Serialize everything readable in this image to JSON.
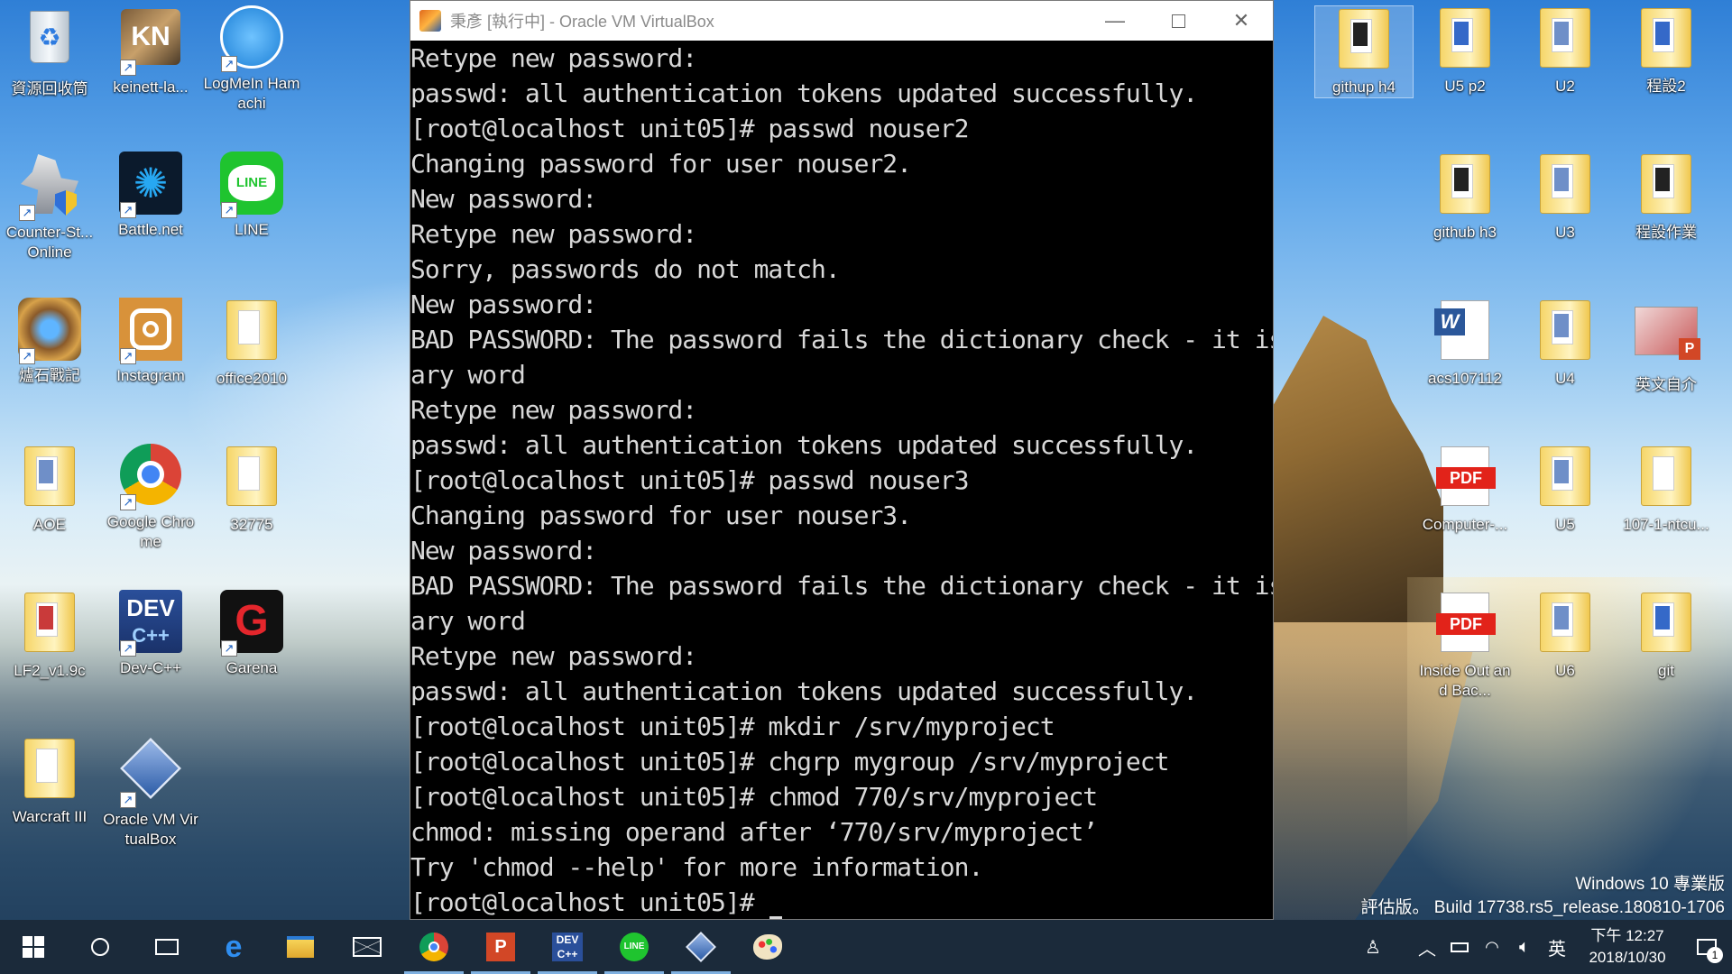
{
  "desktop": {
    "left_icons": [
      {
        "label": "資源回收筒",
        "icon": "recycle-bin-icon"
      },
      {
        "label": "keinett-la...",
        "icon": "keinett-icon"
      },
      {
        "label": "LogMeIn Hamachi",
        "icon": "hamachi-icon"
      },
      {
        "label": "Counter-St... Online",
        "icon": "counter-strike-icon"
      },
      {
        "label": "Battle.net",
        "icon": "battlenet-icon"
      },
      {
        "label": "LINE",
        "icon": "line-icon"
      },
      {
        "label": "爐石戰記",
        "icon": "hearthstone-icon"
      },
      {
        "label": "Instagram",
        "icon": "instagram-icon"
      },
      {
        "label": "office2010",
        "icon": "folder-icon"
      },
      {
        "label": "AOE",
        "icon": "folder-icon"
      },
      {
        "label": "Google Chrome",
        "icon": "chrome-icon"
      },
      {
        "label": "32775",
        "icon": "folder-icon"
      },
      {
        "label": "LF2_v1.9c",
        "icon": "folder-icon"
      },
      {
        "label": "Dev-C++",
        "icon": "devcpp-icon"
      },
      {
        "label": "Garena",
        "icon": "garena-icon"
      },
      {
        "label": "Warcraft III",
        "icon": "folder-icon"
      },
      {
        "label": "Oracle VM VirtualBox",
        "icon": "virtualbox-icon"
      }
    ],
    "right_icons": [
      {
        "label": "githup h4",
        "icon": "folder-icon"
      },
      {
        "label": "U5 p2",
        "icon": "folder-icon"
      },
      {
        "label": "U2",
        "icon": "folder-icon"
      },
      {
        "label": "程設2",
        "icon": "folder-icon"
      },
      {
        "label": "github h3",
        "icon": "folder-icon"
      },
      {
        "label": "U3",
        "icon": "folder-icon"
      },
      {
        "label": "程設作業",
        "icon": "folder-icon"
      },
      {
        "label": "acs107112",
        "icon": "word-doc-icon"
      },
      {
        "label": "U4",
        "icon": "folder-icon"
      },
      {
        "label": "英文自介",
        "icon": "powerpoint-icon"
      },
      {
        "label": "Computer-...",
        "icon": "pdf-icon"
      },
      {
        "label": "U5",
        "icon": "folder-icon"
      },
      {
        "label": "107-1-ntcu...",
        "icon": "folder-icon"
      },
      {
        "label": "Inside Out and Bac...",
        "icon": "pdf-icon"
      },
      {
        "label": "U6",
        "icon": "folder-icon"
      },
      {
        "label": "git",
        "icon": "folder-icon"
      }
    ]
  },
  "vbox": {
    "title": "秉彥 [執行中] - Oracle VM VirtualBox",
    "terminal_lines": [
      "Retype new password:",
      "passwd: all authentication tokens updated successfully.",
      "[root@localhost unit05]# passwd nouser2",
      "Changing password for user nouser2.",
      "New password:",
      "Retype new password:",
      "Sorry, passwords do not match.",
      "New password:",
      "BAD PASSWORD: The password fails the dictionary check - it is based on a diction",
      "ary word",
      "Retype new password:",
      "passwd: all authentication tokens updated successfully.",
      "[root@localhost unit05]# passwd nouser3",
      "Changing password for user nouser3.",
      "New password:",
      "BAD PASSWORD: The password fails the dictionary check - it is based on a diction",
      "ary word",
      "Retype new password:",
      "passwd: all authentication tokens updated successfully.",
      "[root@localhost unit05]# mkdir /srv/myproject",
      "[root@localhost unit05]# chgrp mygroup /srv/myproject",
      "[root@localhost unit05]# chmod 770/srv/myproject",
      "chmod: missing operand after ‘770/srv/myproject’",
      "Try 'chmod --help' for more information.",
      "[root@localhost unit05]# "
    ]
  },
  "watermark": {
    "line1": "Windows 10 專業版",
    "line2": "評估版。 Build 17738.rs5_release.180810-1706"
  },
  "taskbar": {
    "pinned": [
      "start-icon",
      "search-icon",
      "task-view-icon",
      "edge-icon",
      "file-explorer-icon",
      "mail-icon",
      "chrome-icon",
      "powerpoint-icon",
      "devcpp-icon",
      "line-icon",
      "virtualbox-icon",
      "paint-icon"
    ],
    "ime": "英",
    "time": "下午 12:27",
    "date": "2018/10/30",
    "notification_count": "1"
  }
}
